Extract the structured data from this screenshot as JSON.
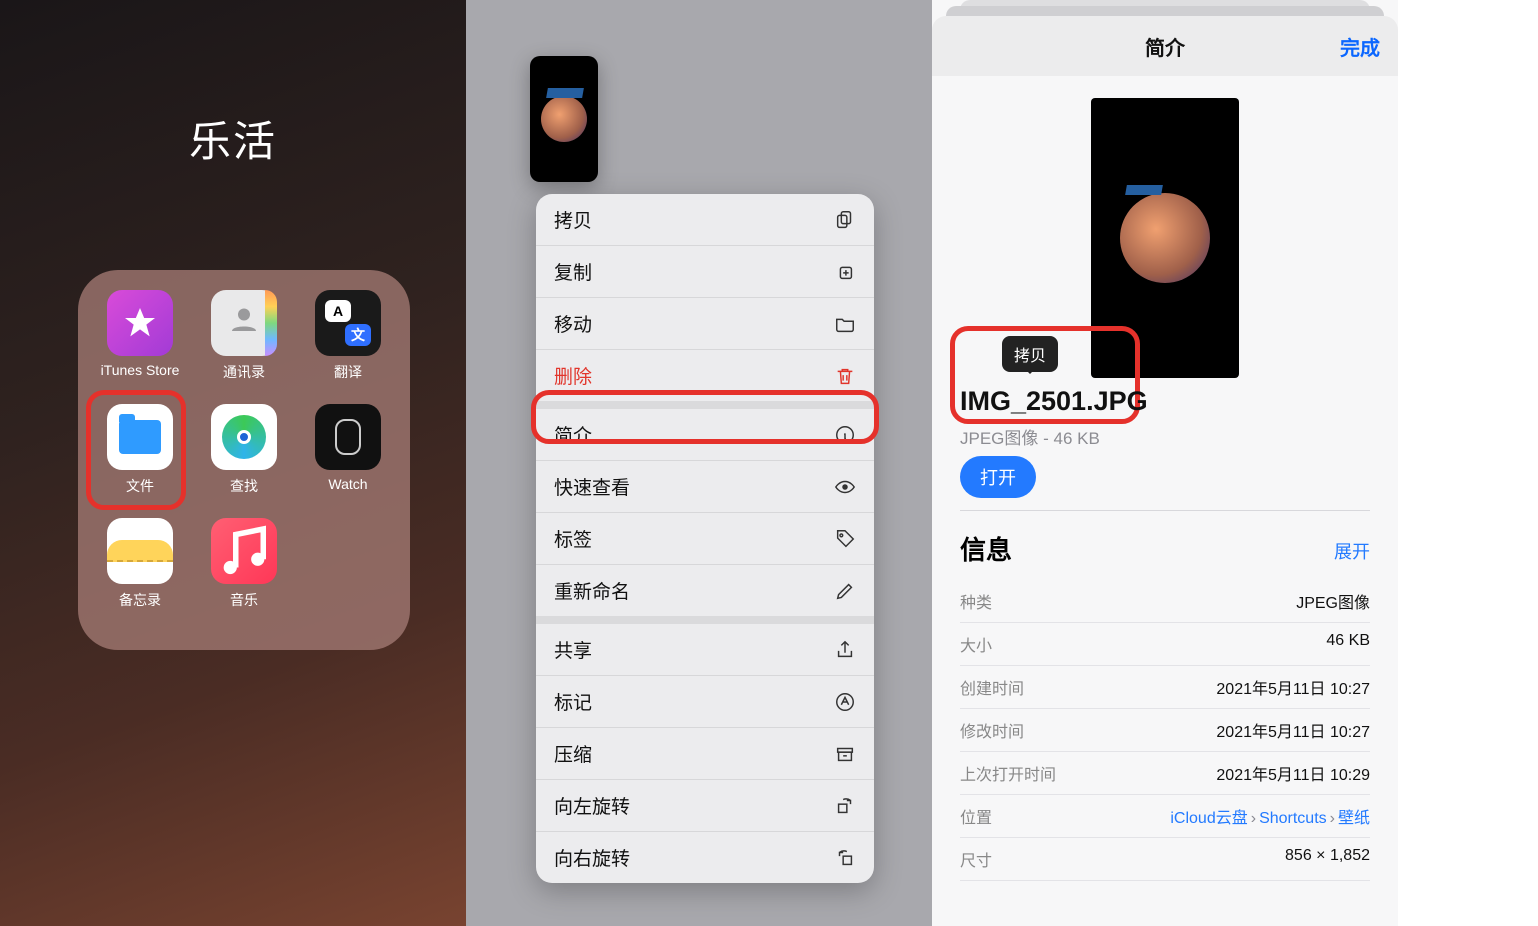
{
  "panel1": {
    "folder_title": "乐活",
    "apps": [
      {
        "label": "iTunes Store",
        "key": "itunes"
      },
      {
        "label": "通讯录",
        "key": "contacts"
      },
      {
        "label": "翻译",
        "key": "translate"
      },
      {
        "label": "文件",
        "key": "files"
      },
      {
        "label": "查找",
        "key": "findmy"
      },
      {
        "label": "Watch",
        "key": "watch"
      },
      {
        "label": "备忘录",
        "key": "notes"
      },
      {
        "label": "音乐",
        "key": "music"
      }
    ],
    "highlighted_app": "files"
  },
  "panel2": {
    "groups": [
      {
        "items": [
          {
            "label": "拷贝",
            "icon": "copy"
          },
          {
            "label": "复制",
            "icon": "duplicate"
          },
          {
            "label": "移动",
            "icon": "folder"
          },
          {
            "label": "删除",
            "icon": "trash",
            "destructive": true
          }
        ]
      },
      {
        "items": [
          {
            "label": "简介",
            "icon": "info",
            "highlighted": true
          },
          {
            "label": "快速查看",
            "icon": "eye"
          },
          {
            "label": "标签",
            "icon": "tag"
          },
          {
            "label": "重新命名",
            "icon": "pencil"
          }
        ]
      },
      {
        "items": [
          {
            "label": "共享",
            "icon": "share"
          },
          {
            "label": "标记",
            "icon": "markup"
          },
          {
            "label": "压缩",
            "icon": "archive"
          },
          {
            "label": "向左旋转",
            "icon": "rotate-left"
          },
          {
            "label": "向右旋转",
            "icon": "rotate-right"
          }
        ]
      }
    ]
  },
  "panel3": {
    "nav_title": "简介",
    "done": "完成",
    "copy_tooltip": "拷贝",
    "file_name": "IMG_2501.JPG",
    "file_sub": "JPEG图像 - 46 KB",
    "open": "打开",
    "info_header": "信息",
    "expand": "展开",
    "rows": [
      {
        "k": "种类",
        "v": "JPEG图像"
      },
      {
        "k": "大小",
        "v": "46 KB"
      },
      {
        "k": "创建时间",
        "v": "2021年5月11日 10:27"
      },
      {
        "k": "修改时间",
        "v": "2021年5月11日 10:27"
      },
      {
        "k": "上次打开时间",
        "v": "2021年5月11日 10:29"
      },
      {
        "k": "位置",
        "v": "",
        "link_parts": [
          "iCloud云盘",
          "Shortcuts",
          "壁纸"
        ]
      },
      {
        "k": "尺寸",
        "v": "856 × 1,852"
      }
    ]
  }
}
